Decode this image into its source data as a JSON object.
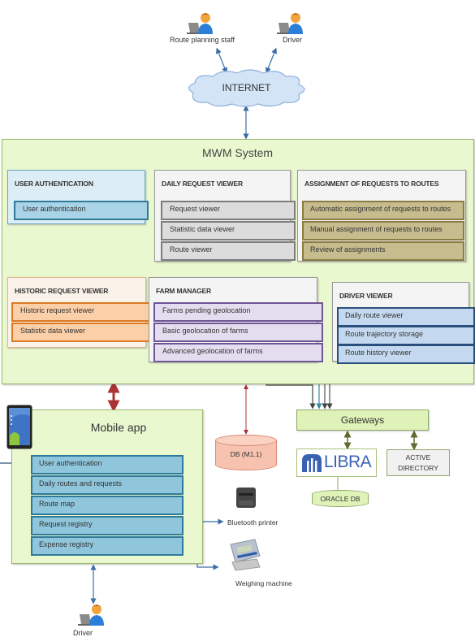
{
  "users": {
    "top_left": {
      "label": "Route planning staff",
      "icon": "user-laptop-icon"
    },
    "top_right": {
      "label": "Driver",
      "icon": "user-laptop-icon"
    },
    "bottom": {
      "label": "Driver",
      "icon": "user-laptop-icon"
    }
  },
  "internet": {
    "label": "INTERNET"
  },
  "system": {
    "title": "MWM System",
    "panels": {
      "auth": {
        "title": "USER AUTHENTICATION",
        "items": [
          "User authentication"
        ]
      },
      "daily": {
        "title": "DAILY REQUEST VIEWER",
        "items": [
          "Request viewer",
          "Statistic data viewer",
          "Route viewer"
        ]
      },
      "assign": {
        "title": "ASSIGNMENT OF REQUESTS TO ROUTES",
        "items": [
          "Automatic assignment of requests to routes",
          "Manual assignment of requests to routes",
          "Review of assignments"
        ]
      },
      "hist": {
        "title": "HISTORIC REQUEST VIEWER",
        "items": [
          "Historic request viewer",
          "Statistic data viewer"
        ]
      },
      "farm": {
        "title": "FARM MANAGER",
        "items": [
          "Farms pending geolocation",
          "Basic geolocation of farms",
          "Advanced geolocation of farms"
        ]
      },
      "driver": {
        "title": "DRIVER VIEWER",
        "items": [
          "Daily route viewer",
          "Route trajectory storage",
          "Route history viewer"
        ]
      }
    }
  },
  "mobile": {
    "title": "Mobile app",
    "items": [
      "User authentication",
      "Daily routes and requests",
      "Route map",
      "Request registry",
      "Expense registry"
    ]
  },
  "db": {
    "label": "DB (M1.1)"
  },
  "gateways": {
    "label": "Gateways"
  },
  "libra": {
    "label": "LIBRA"
  },
  "active_directory": {
    "line1": "ACTIVE",
    "line2": "DIRECTORY"
  },
  "oracle": {
    "label": "ORACLE DB"
  },
  "devices": {
    "printer": "Bluetooth printer",
    "scale": "Weighing machine"
  },
  "colors": {
    "system_bg": "#eaf8d0",
    "connector_blue": "#3b6ea5",
    "connector_red": "#a33",
    "connector_teal": "#3a8aa8",
    "connector_dark": "#555",
    "connector_green": "#5d6b2f"
  }
}
